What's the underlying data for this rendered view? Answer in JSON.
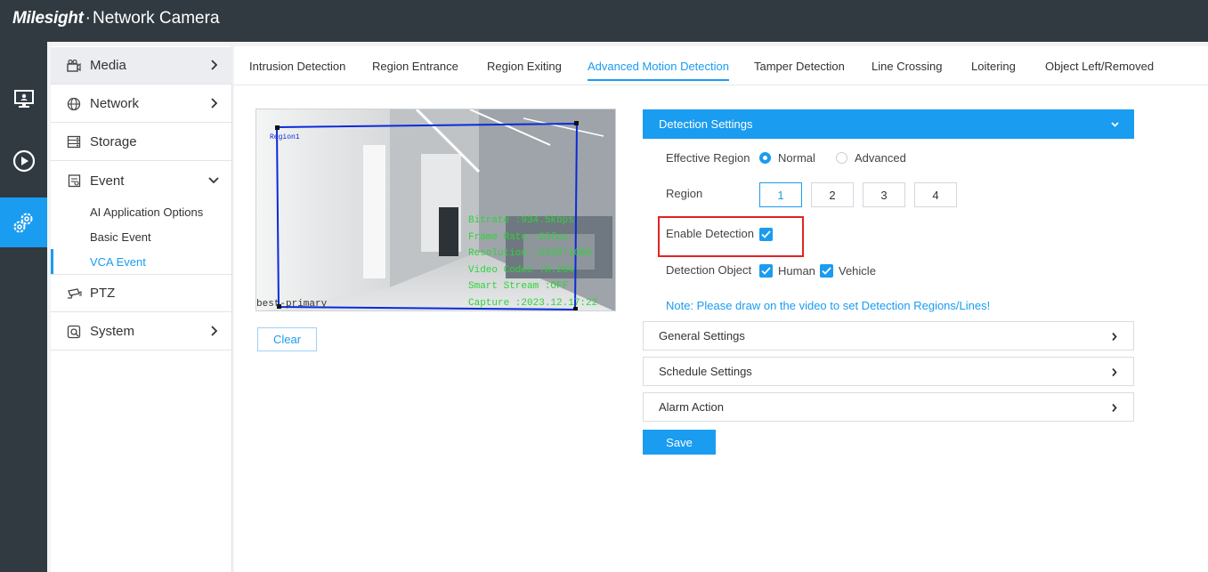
{
  "app": {
    "logo": "Milesight",
    "separator": "·",
    "title": "Network Camera"
  },
  "sidebar": {
    "items": [
      {
        "label": "Media"
      },
      {
        "label": "Network"
      },
      {
        "label": "Storage"
      },
      {
        "label": "Event"
      },
      {
        "label": "PTZ"
      },
      {
        "label": "System"
      }
    ],
    "event_sub": [
      {
        "label": "AI Application Options"
      },
      {
        "label": "Basic Event"
      },
      {
        "label": "VCA Event"
      }
    ]
  },
  "tabs": [
    {
      "label": "Intrusion Detection"
    },
    {
      "label": "Region Entrance"
    },
    {
      "label": "Region Exiting"
    },
    {
      "label": "Advanced Motion Detection"
    },
    {
      "label": "Tamper Detection"
    },
    {
      "label": "Line Crossing"
    },
    {
      "label": "Loitering"
    },
    {
      "label": "Object Left/Removed"
    }
  ],
  "video": {
    "region_label": "Region1",
    "stream_label": "best-primary",
    "overlay": [
      "Bitrate :934.5kbps",
      "Frame Rate :25fps",
      "Resolution :1920*1080",
      "Video Codec :H.264",
      "Smart Stream :OFF",
      "Capture :2023.12.17:22"
    ]
  },
  "clear_label": "Clear",
  "detection": {
    "header": "Detection Settings",
    "effective_region_label": "Effective Region",
    "normal_label": "Normal",
    "advanced_label": "Advanced",
    "region_label": "Region",
    "regions": [
      "1",
      "2",
      "3",
      "4"
    ],
    "enable_label": "Enable Detection",
    "object_label": "Detection Object",
    "human_label": "Human",
    "vehicle_label": "Vehicle",
    "note": "Note: Please draw on the video to set Detection Regions/Lines!"
  },
  "sections": [
    {
      "label": "General Settings"
    },
    {
      "label": "Schedule Settings"
    },
    {
      "label": "Alarm Action"
    }
  ],
  "save_label": "Save",
  "colors": {
    "accent": "#1a9cf0",
    "topbar": "#313a41",
    "highlight": "#e02424"
  }
}
